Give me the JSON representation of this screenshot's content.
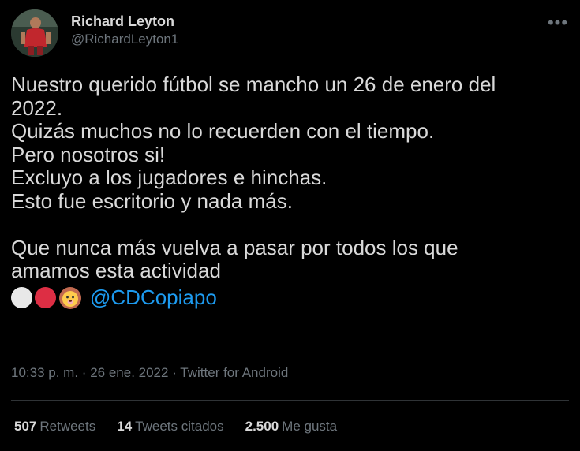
{
  "author": {
    "display_name": "Richard Leyton",
    "handle": "@RichardLeyton1"
  },
  "tweet": {
    "lines": [
      "Nuestro querido fútbol se mancho un 26 de enero del",
      "2022.",
      "Quizás muchos no lo recuerden con el tiempo.",
      "Pero nosotros si!",
      "Excluyo a los jugadores e hinchas.",
      "Esto fue escritorio y nada más.",
      "",
      "Que nunca más vuelva a pasar por todos los que",
      "amamos esta actividad"
    ],
    "emojis": [
      "white-circle",
      "red-circle",
      "lion-face"
    ],
    "mention": "@CDCopiapo"
  },
  "meta": {
    "time": "10:33 p. m.",
    "date": "26 ene. 2022",
    "separator": "·",
    "source": "Twitter for Android"
  },
  "stats": {
    "retweets_count": "507",
    "retweets_label": "Retweets",
    "quotes_count": "14",
    "quotes_label": "Tweets citados",
    "likes_count": "2.500",
    "likes_label": "Me gusta"
  },
  "colors": {
    "background": "#000000",
    "text": "#d9d9d9",
    "secondary": "#6e767d",
    "link": "#1d9bf0",
    "divider": "#2f3336"
  },
  "icons": [
    "more-icon",
    "avatar-image"
  ]
}
